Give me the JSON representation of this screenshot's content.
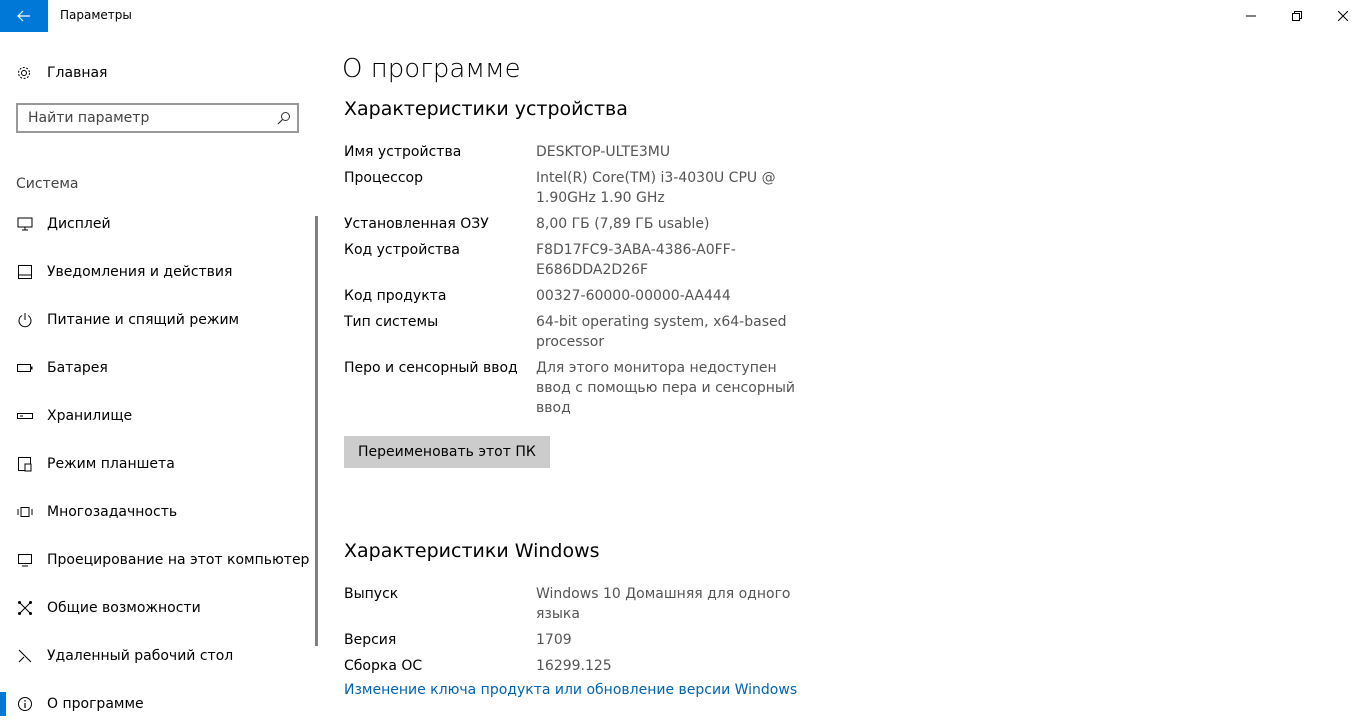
{
  "window": {
    "title": "Параметры"
  },
  "sidebar": {
    "home_label": "Главная",
    "search_placeholder": "Найти параметр",
    "section_header": "Система",
    "items": [
      {
        "label": "Дисплей",
        "icon": "monitor-icon"
      },
      {
        "label": "Уведомления и действия",
        "icon": "notification-icon"
      },
      {
        "label": "Питание и спящий режим",
        "icon": "power-icon"
      },
      {
        "label": "Батарея",
        "icon": "battery-icon"
      },
      {
        "label": "Хранилище",
        "icon": "storage-icon"
      },
      {
        "label": "Режим планшета",
        "icon": "tablet-icon"
      },
      {
        "label": "Многозадачность",
        "icon": "multitasking-icon"
      },
      {
        "label": "Проецирование на этот компьютер",
        "icon": "projecting-icon"
      },
      {
        "label": "Общие возможности",
        "icon": "shared-experiences-icon"
      },
      {
        "label": "Удаленный рабочий стол",
        "icon": "remote-desktop-icon"
      },
      {
        "label": "О программе",
        "icon": "info-icon",
        "active": true
      }
    ]
  },
  "main": {
    "title": "О программе",
    "device_section": {
      "heading": "Характеристики устройства",
      "rows": [
        {
          "key": "Имя устройства",
          "value": "DESKTOP-ULTE3MU"
        },
        {
          "key": "Процессор",
          "value": "Intel(R) Core(TM) i3-4030U CPU @ 1.90GHz   1.90 GHz"
        },
        {
          "key": "Установленная ОЗУ",
          "value": "8,00 ГБ (7,89 ГБ usable)"
        },
        {
          "key": "Код устройства",
          "value": "F8D17FC9-3ABA-4386-A0FF-E686DDA2D26F"
        },
        {
          "key": "Код продукта",
          "value": "00327-60000-00000-AA444"
        },
        {
          "key": "Тип системы",
          "value": "64-bit operating system, x64-based processor"
        },
        {
          "key": "Перо и сенсорный ввод",
          "value": "Для этого монитора недоступен ввод с помощью пера и сенсорный ввод"
        }
      ],
      "rename_button": "Переименовать этот ПК"
    },
    "windows_section": {
      "heading": "Характеристики Windows",
      "rows": [
        {
          "key": "Выпуск",
          "value": "Windows 10 Домашняя для одного языка"
        },
        {
          "key": "Версия",
          "value": "1709"
        },
        {
          "key": "Сборка ОС",
          "value": "16299.125"
        }
      ],
      "change_key_link": "Изменение ключа продукта или обновление версии Windows"
    }
  },
  "colors": {
    "accent": "#0078d7",
    "link": "#0063b1",
    "button_bg": "#cccccc"
  }
}
